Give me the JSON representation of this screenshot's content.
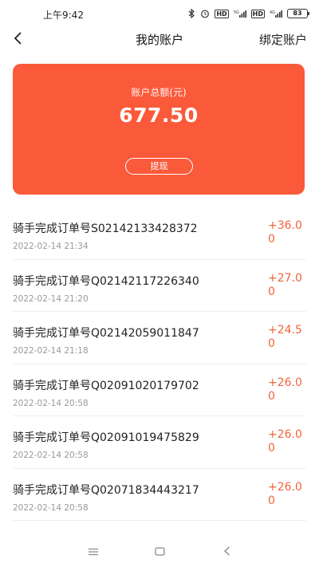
{
  "status_bar": {
    "time": "上午9:42",
    "network_1": "5G",
    "network_2": "4G",
    "battery": "83"
  },
  "nav": {
    "title": "我的账户",
    "action_label": "绑定账户"
  },
  "balance": {
    "label": "账户总额(元)",
    "amount": "677.50",
    "withdraw_label": "提现",
    "accent": "#fa5a3a"
  },
  "transactions": [
    {
      "title": "骑手完成订单号S02142133428372",
      "time": "2022-02-14 21:34",
      "amount": "+36.00"
    },
    {
      "title": "骑手完成订单号Q02142117226340",
      "time": "2022-02-14 21:20",
      "amount": "+27.00"
    },
    {
      "title": "骑手完成订单号Q02142059011847",
      "time": "2022-02-14 21:18",
      "amount": "+24.50"
    },
    {
      "title": "骑手完成订单号Q02091020179702",
      "time": "2022-02-14 20:58",
      "amount": "+26.00"
    },
    {
      "title": "骑手完成订单号Q02091019475829",
      "time": "2022-02-14 20:58",
      "amount": "+26.00"
    },
    {
      "title": "骑手完成订单号Q02071834443217",
      "time": "2022-02-14 20:58",
      "amount": "+26.00"
    }
  ],
  "colors": {
    "amount": "#f0643c",
    "time": "#999999"
  },
  "icons": {
    "back": "chevron-left-icon",
    "system_menu": "menu-icon",
    "system_home": "home-square-icon",
    "system_back": "back-triangle-icon"
  }
}
